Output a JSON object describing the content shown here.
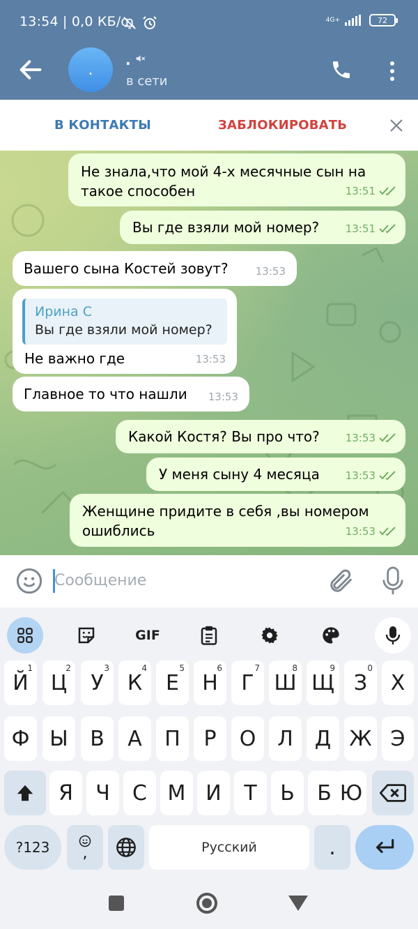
{
  "status_bar": {
    "time": "13:54 | 0,0 КБ/с",
    "network": "4G+",
    "battery": "72"
  },
  "header": {
    "avatar_letter": ".",
    "name": ".",
    "status": "в сети"
  },
  "action_bar": {
    "add_contact": "В КОНТАКТЫ",
    "block": "ЗАБЛОКИРОВАТЬ"
  },
  "messages": [
    {
      "dir": "out",
      "text": "Не знала,что мой 4-х месячные сын на такое способен",
      "time": "13:51"
    },
    {
      "dir": "out",
      "text": "Вы где взяли мой номер?",
      "time": "13:51"
    },
    {
      "dir": "in",
      "text": "Вашего сына Костей зовут?",
      "time": "13:53"
    },
    {
      "dir": "in",
      "text": "Не важно где",
      "time": "13:53",
      "reply_name": "Ирина С",
      "reply_text": "Вы где взяли мой номер?"
    },
    {
      "dir": "in",
      "text": "Главное то что нашли",
      "time": "13:53"
    },
    {
      "dir": "out",
      "text": "Какой Костя? Вы про что?",
      "time": "13:53"
    },
    {
      "dir": "out",
      "text": "У меня сыну 4 месяца",
      "time": "13:53"
    },
    {
      "dir": "out",
      "text": "Женщине придите в себя ,вы номером ошиблись",
      "time": "13:53"
    }
  ],
  "input": {
    "placeholder": "Сообщение"
  },
  "keyboard": {
    "toolbar_gif": "GIF",
    "row1": [
      "Й",
      "Ц",
      "У",
      "К",
      "Е",
      "Н",
      "Г",
      "Ш",
      "Щ",
      "З",
      "Х"
    ],
    "row1_hints": [
      "1",
      "2",
      "3",
      "4",
      "5",
      "6",
      "7",
      "8",
      "9",
      "0",
      ""
    ],
    "row2": [
      "Ф",
      "Ы",
      "В",
      "А",
      "П",
      "Р",
      "О",
      "Л",
      "Д",
      "Ж",
      "Э"
    ],
    "row3": [
      "Я",
      "Ч",
      "С",
      "М",
      "И",
      "Т",
      "Ь",
      "Б",
      "Ю"
    ],
    "symbols_key": "?123",
    "emoji_comma": ",",
    "space_label": "Русский",
    "period": "."
  },
  "colors": {
    "header_bg": "#5b7fa5",
    "outgoing_bubble": "#effedd",
    "incoming_bubble": "#ffffff",
    "accent_blue": "#3f7ab3",
    "block_red": "#d1433f",
    "read_tick": "#6fae62"
  }
}
